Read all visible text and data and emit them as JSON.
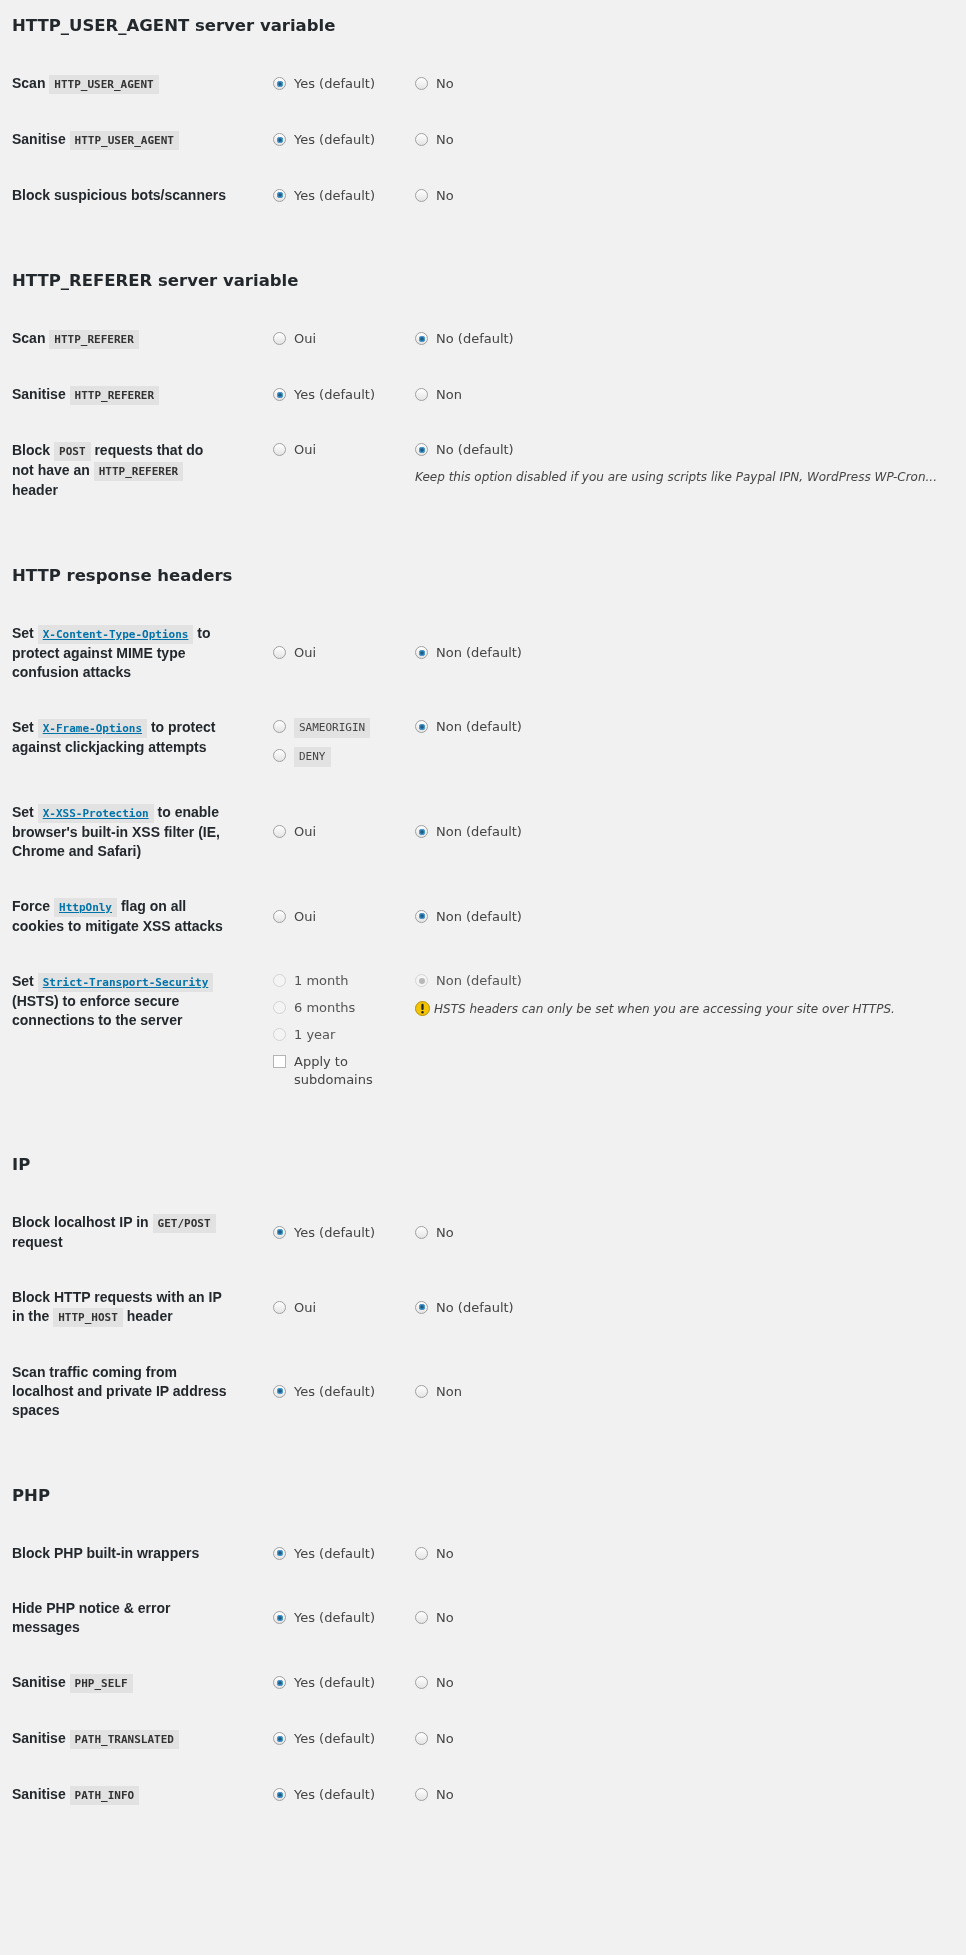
{
  "sections": [
    {
      "title": "HTTP_USER_AGENT server variable",
      "rows": [
        {
          "parts": [
            {
              "kind": "text",
              "text": "Scan"
            },
            {
              "kind": "code",
              "text": "HTTP_USER_AGENT"
            }
          ],
          "columns": [
            [
              {
                "kind": "radio",
                "label": "Yes (default)",
                "selected": true,
                "disabled": false
              }
            ],
            [
              {
                "kind": "radio",
                "label": "No",
                "selected": false,
                "disabled": false
              }
            ]
          ]
        },
        {
          "parts": [
            {
              "kind": "text",
              "text": "Sanitise"
            },
            {
              "kind": "code",
              "text": "HTTP_USER_AGENT"
            }
          ],
          "columns": [
            [
              {
                "kind": "radio",
                "label": "Yes (default)",
                "selected": true,
                "disabled": false
              }
            ],
            [
              {
                "kind": "radio",
                "label": "No",
                "selected": false,
                "disabled": false
              }
            ]
          ]
        },
        {
          "parts": [
            {
              "kind": "text",
              "text": "Block suspicious bots/scanners"
            }
          ],
          "columns": [
            [
              {
                "kind": "radio",
                "label": "Yes (default)",
                "selected": true,
                "disabled": false
              }
            ],
            [
              {
                "kind": "radio",
                "label": "No",
                "selected": false,
                "disabled": false
              }
            ]
          ]
        }
      ]
    },
    {
      "title": "HTTP_REFERER server variable",
      "rows": [
        {
          "parts": [
            {
              "kind": "text",
              "text": "Scan"
            },
            {
              "kind": "code",
              "text": "HTTP_REFERER"
            }
          ],
          "columns": [
            [
              {
                "kind": "radio",
                "label": "Oui",
                "selected": false,
                "disabled": false
              }
            ],
            [
              {
                "kind": "radio",
                "label": "No (default)",
                "selected": true,
                "disabled": false
              }
            ]
          ]
        },
        {
          "parts": [
            {
              "kind": "text",
              "text": "Sanitise"
            },
            {
              "kind": "code",
              "text": "HTTP_REFERER"
            }
          ],
          "columns": [
            [
              {
                "kind": "radio",
                "label": "Yes (default)",
                "selected": true,
                "disabled": false
              }
            ],
            [
              {
                "kind": "radio",
                "label": "Non",
                "selected": false,
                "disabled": false
              }
            ]
          ]
        },
        {
          "parts": [
            {
              "kind": "text",
              "text": "Block"
            },
            {
              "kind": "code",
              "text": "POST"
            },
            {
              "kind": "text",
              "text": "requests that do not have an"
            },
            {
              "kind": "code",
              "text": "HTTP_REFERER"
            },
            {
              "kind": "text",
              "text": "header"
            }
          ],
          "columns": [
            [
              {
                "kind": "radio",
                "label": "Oui",
                "selected": false,
                "disabled": false
              }
            ],
            [
              {
                "kind": "radio",
                "label": "No (default)",
                "selected": true,
                "disabled": false
              }
            ]
          ],
          "note": {
            "kind": "plain",
            "text": "Keep this option disabled if you are using scripts like Paypal IPN, WordPress WP-Cron..."
          }
        }
      ]
    },
    {
      "title": "HTTP response headers",
      "rows": [
        {
          "parts": [
            {
              "kind": "text",
              "text": "Set"
            },
            {
              "kind": "link",
              "text": "X-Content-Type-Options"
            },
            {
              "kind": "text",
              "text": "to protect against MIME type confusion attacks"
            }
          ],
          "columns": [
            [
              {
                "kind": "radio",
                "label": "Oui",
                "selected": false,
                "disabled": false
              }
            ],
            [
              {
                "kind": "radio",
                "label": "Non (default)",
                "selected": true,
                "disabled": false
              }
            ]
          ]
        },
        {
          "parts": [
            {
              "kind": "text",
              "text": "Set"
            },
            {
              "kind": "link",
              "text": "X-Frame-Options"
            },
            {
              "kind": "text",
              "text": "to protect against clickjacking attempts"
            }
          ],
          "columns": [
            [
              {
                "kind": "radio",
                "label": "SAMEORIGIN",
                "code": true,
                "selected": false,
                "disabled": false
              },
              {
                "kind": "radio",
                "label": "DENY",
                "code": true,
                "selected": false,
                "disabled": false
              }
            ],
            [
              {
                "kind": "radio",
                "label": "Non (default)",
                "selected": true,
                "disabled": false
              }
            ]
          ]
        },
        {
          "parts": [
            {
              "kind": "text",
              "text": "Set"
            },
            {
              "kind": "link",
              "text": "X-XSS-Protection"
            },
            {
              "kind": "text",
              "text": "to enable browser's built-in XSS filter (IE, Chrome and Safari)"
            }
          ],
          "columns": [
            [
              {
                "kind": "radio",
                "label": "Oui",
                "selected": false,
                "disabled": false
              }
            ],
            [
              {
                "kind": "radio",
                "label": "Non (default)",
                "selected": true,
                "disabled": false
              }
            ]
          ]
        },
        {
          "parts": [
            {
              "kind": "text",
              "text": "Force"
            },
            {
              "kind": "link",
              "text": "HttpOnly"
            },
            {
              "kind": "text",
              "text": "flag on all cookies to mitigate XSS attacks"
            }
          ],
          "columns": [
            [
              {
                "kind": "radio",
                "label": "Oui",
                "selected": false,
                "disabled": false
              }
            ],
            [
              {
                "kind": "radio",
                "label": "Non (default)",
                "selected": true,
                "disabled": false
              }
            ]
          ]
        },
        {
          "parts": [
            {
              "kind": "text",
              "text": "Set"
            },
            {
              "kind": "link",
              "text": "Strict-Transport-Security"
            },
            {
              "kind": "text",
              "text": "(HSTS) to enforce secure connections to the server"
            }
          ],
          "columns": [
            [
              {
                "kind": "radio",
                "label": "1 month",
                "selected": false,
                "disabled": true
              },
              {
                "kind": "radio",
                "label": "6 months",
                "selected": false,
                "disabled": true
              },
              {
                "kind": "radio",
                "label": "1 year",
                "selected": false,
                "disabled": true
              },
              {
                "kind": "checkbox",
                "label": "Apply to subdomains",
                "checked": false,
                "disabled": false
              }
            ],
            [
              {
                "kind": "radio",
                "label": "Non (default)",
                "selected": true,
                "disabled": true
              }
            ]
          ],
          "note": {
            "kind": "warning",
            "text": "HSTS headers can only be set when you are accessing your site over HTTPS."
          }
        }
      ]
    },
    {
      "title": "IP",
      "rows": [
        {
          "parts": [
            {
              "kind": "text",
              "text": "Block localhost IP in"
            },
            {
              "kind": "code",
              "text": "GET/POST"
            },
            {
              "kind": "text",
              "text": "request"
            }
          ],
          "columns": [
            [
              {
                "kind": "radio",
                "label": "Yes (default)",
                "selected": true,
                "disabled": false
              }
            ],
            [
              {
                "kind": "radio",
                "label": "No",
                "selected": false,
                "disabled": false
              }
            ]
          ]
        },
        {
          "parts": [
            {
              "kind": "text",
              "text": "Block HTTP requests with an IP in the"
            },
            {
              "kind": "code",
              "text": "HTTP_HOST"
            },
            {
              "kind": "text",
              "text": "header"
            }
          ],
          "columns": [
            [
              {
                "kind": "radio",
                "label": "Oui",
                "selected": false,
                "disabled": false
              }
            ],
            [
              {
                "kind": "radio",
                "label": "No (default)",
                "selected": true,
                "disabled": false
              }
            ]
          ]
        },
        {
          "parts": [
            {
              "kind": "text",
              "text": "Scan traffic coming from localhost and private IP address spaces"
            }
          ],
          "columns": [
            [
              {
                "kind": "radio",
                "label": "Yes (default)",
                "selected": true,
                "disabled": false
              }
            ],
            [
              {
                "kind": "radio",
                "label": "Non",
                "selected": false,
                "disabled": false
              }
            ]
          ]
        }
      ]
    },
    {
      "title": "PHP",
      "rows": [
        {
          "parts": [
            {
              "kind": "text",
              "text": "Block PHP built-in wrappers"
            }
          ],
          "columns": [
            [
              {
                "kind": "radio",
                "label": "Yes (default)",
                "selected": true,
                "disabled": false
              }
            ],
            [
              {
                "kind": "radio",
                "label": "No",
                "selected": false,
                "disabled": false
              }
            ]
          ]
        },
        {
          "parts": [
            {
              "kind": "text",
              "text": "Hide PHP notice & error messages"
            }
          ],
          "columns": [
            [
              {
                "kind": "radio",
                "label": "Yes (default)",
                "selected": true,
                "disabled": false
              }
            ],
            [
              {
                "kind": "radio",
                "label": "No",
                "selected": false,
                "disabled": false
              }
            ]
          ]
        },
        {
          "parts": [
            {
              "kind": "text",
              "text": "Sanitise"
            },
            {
              "kind": "code",
              "text": "PHP_SELF"
            }
          ],
          "columns": [
            [
              {
                "kind": "radio",
                "label": "Yes (default)",
                "selected": true,
                "disabled": false
              }
            ],
            [
              {
                "kind": "radio",
                "label": "No",
                "selected": false,
                "disabled": false
              }
            ]
          ]
        },
        {
          "parts": [
            {
              "kind": "text",
              "text": "Sanitise"
            },
            {
              "kind": "code",
              "text": "PATH_TRANSLATED"
            }
          ],
          "columns": [
            [
              {
                "kind": "radio",
                "label": "Yes (default)",
                "selected": true,
                "disabled": false
              }
            ],
            [
              {
                "kind": "radio",
                "label": "No",
                "selected": false,
                "disabled": false
              }
            ]
          ]
        },
        {
          "parts": [
            {
              "kind": "text",
              "text": "Sanitise"
            },
            {
              "kind": "code",
              "text": "PATH_INFO"
            }
          ],
          "columns": [
            [
              {
                "kind": "radio",
                "label": "Yes (default)",
                "selected": true,
                "disabled": false
              }
            ],
            [
              {
                "kind": "radio",
                "label": "No",
                "selected": false,
                "disabled": false
              }
            ]
          ]
        }
      ]
    }
  ]
}
